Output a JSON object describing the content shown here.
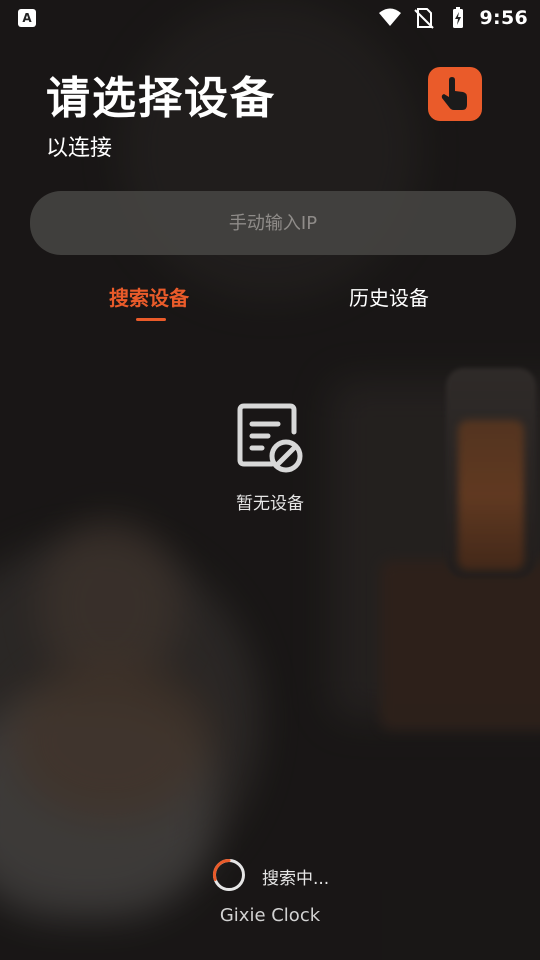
{
  "status_bar": {
    "time": "9:56",
    "left_icon_letter": "A",
    "icons": [
      "wifi-icon",
      "no-sim-icon",
      "battery-charging-icon"
    ]
  },
  "header": {
    "title": "请选择设备",
    "subtitle": "以连接",
    "touch_button_icon": "hand-tap-icon"
  },
  "ip_input": {
    "placeholder": "手动输入IP",
    "value": ""
  },
  "tabs": [
    {
      "label": "搜索设备",
      "active": true
    },
    {
      "label": "历史设备",
      "active": false
    }
  ],
  "empty_state": {
    "icon": "no-document-icon",
    "text": "暂无设备"
  },
  "searching": {
    "text": "搜索中..."
  },
  "app_name": "Gixie Clock",
  "colors": {
    "accent": "#ea5b2a",
    "input_bg": "#484644",
    "text": "#ffffff"
  }
}
